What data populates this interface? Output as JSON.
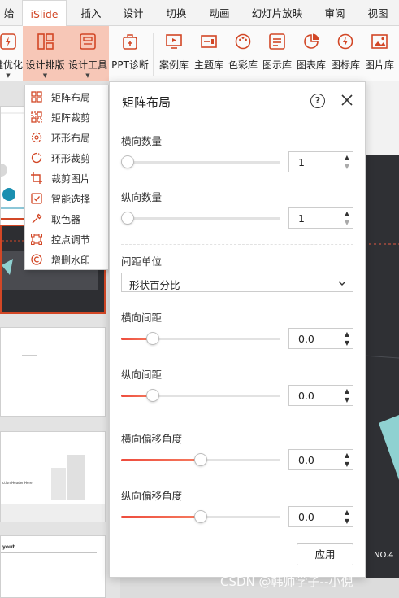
{
  "tabs": [
    "始",
    "iSlide",
    "插入",
    "设计",
    "切换",
    "动画",
    "幻灯片放映",
    "审阅",
    "视图"
  ],
  "active_tab": "iSlide",
  "ribbon": {
    "buttons": [
      {
        "label": "键优化",
        "icon": "lightning-icon",
        "dropdown": true
      },
      {
        "label": "设计排版",
        "icon": "layout-icon",
        "dropdown": true
      },
      {
        "label": "设计工具",
        "icon": "tools-icon",
        "dropdown": true
      },
      {
        "label": "PPT诊断",
        "icon": "diagnose-icon",
        "dropdown": false
      },
      {
        "label": "案例库",
        "icon": "case-library-icon",
        "dropdown": false
      },
      {
        "label": "主题库",
        "icon": "theme-library-icon",
        "dropdown": false
      },
      {
        "label": "色彩库",
        "icon": "palette-icon",
        "dropdown": false
      },
      {
        "label": "图示库",
        "icon": "diagram-library-icon",
        "dropdown": false
      },
      {
        "label": "图表库",
        "icon": "chart-library-icon",
        "dropdown": false
      },
      {
        "label": "图标库",
        "icon": "icon-library-icon",
        "dropdown": false
      },
      {
        "label": "图片库",
        "icon": "picture-library-icon",
        "dropdown": false
      }
    ]
  },
  "menu": {
    "items": [
      {
        "label": "矩阵布局",
        "icon": "matrix-layout-icon"
      },
      {
        "label": "矩阵裁剪",
        "icon": "matrix-crop-icon"
      },
      {
        "label": "环形布局",
        "icon": "ring-layout-icon"
      },
      {
        "label": "环形裁剪",
        "icon": "ring-crop-icon"
      },
      {
        "label": "裁剪图片",
        "icon": "crop-image-icon"
      },
      {
        "label": "智能选择",
        "icon": "smart-select-icon"
      },
      {
        "label": "取色器",
        "icon": "eyedropper-icon"
      },
      {
        "label": "控点调节",
        "icon": "handle-adjust-icon"
      },
      {
        "label": "增删水印",
        "icon": "watermark-icon"
      }
    ]
  },
  "panel": {
    "title": "矩阵布局",
    "help": "?",
    "h_count": {
      "label": "横向数量",
      "value": "1",
      "slider": 0
    },
    "v_count": {
      "label": "纵向数量",
      "value": "1",
      "slider": 0
    },
    "spacing_unit": {
      "label": "间距单位",
      "value": "形状百分比"
    },
    "h_gap": {
      "label": "横向间距",
      "value": "0.0",
      "slider": 0.2
    },
    "v_gap": {
      "label": "纵向间距",
      "value": "0.0",
      "slider": 0.2
    },
    "h_offset": {
      "label": "横向偏移角度",
      "value": "0.0",
      "slider": 0.5
    },
    "v_offset": {
      "label": "纵向偏移角度",
      "value": "0.0",
      "slider": 0.5
    },
    "apply": "应用"
  },
  "slides": {
    "thumb3_text": "ction Header Here",
    "thumb4_text": "yout"
  },
  "page_number": "NO.4",
  "watermark": "CSDN @韩师学子--小倪",
  "colors": {
    "accent": "#d24726",
    "slider": "#ee4b3c",
    "ribbon_active": "#f7c7b7",
    "teal": "#1a8fb0"
  }
}
